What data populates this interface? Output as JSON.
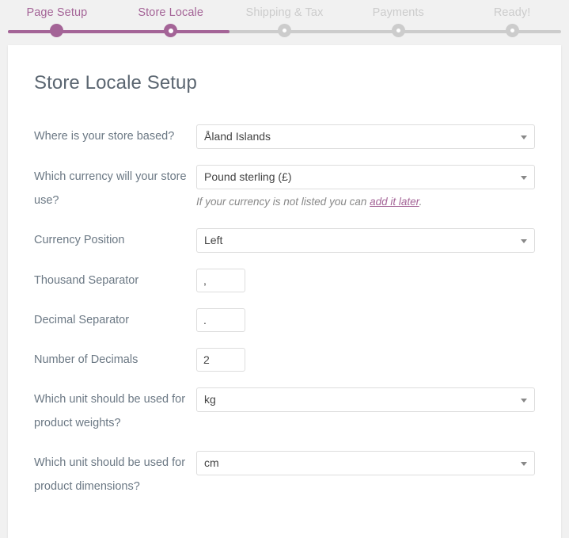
{
  "wizard": {
    "steps": [
      {
        "label": "Page Setup",
        "state": "done"
      },
      {
        "label": "Store Locale",
        "state": "active"
      },
      {
        "label": "Shipping & Tax",
        "state": "upcoming"
      },
      {
        "label": "Payments",
        "state": "upcoming"
      },
      {
        "label": "Ready!",
        "state": "upcoming"
      }
    ],
    "progress_percent": 40,
    "accent_color": "#a46497",
    "inactive_color": "#cccccc"
  },
  "page": {
    "title": "Store Locale Setup",
    "background_color": "#f1f1f1",
    "card_color": "#ffffff"
  },
  "form": {
    "country": {
      "label": "Where is your store based?",
      "value": "Åland Islands",
      "control": "select",
      "arrow_icon": "chevron-down-icon"
    },
    "currency": {
      "label": "Which currency will your store use?",
      "value": "Pound sterling (£)",
      "control": "select",
      "arrow_icon": "chevron-down-icon",
      "helper_prefix": "If your currency is not listed you can ",
      "helper_link": "add it later",
      "helper_suffix": "."
    },
    "currency_position": {
      "label": "Currency Position",
      "value": "Left",
      "control": "select",
      "arrow_icon": "chevron-down-icon"
    },
    "thousand_separator": {
      "label": "Thousand Separator",
      "value": ",",
      "control": "text"
    },
    "decimal_separator": {
      "label": "Decimal Separator",
      "value": ".",
      "control": "text"
    },
    "number_of_decimals": {
      "label": "Number of Decimals",
      "value": "2",
      "control": "text"
    },
    "weight_unit": {
      "label": "Which unit should be used for product weights?",
      "value": "kg",
      "control": "select",
      "arrow_icon": "chevron-down-icon"
    },
    "dimension_unit": {
      "label": "Which unit should be used for product dimensions?",
      "value": "cm",
      "control": "select",
      "arrow_icon": "chevron-down-icon"
    }
  }
}
